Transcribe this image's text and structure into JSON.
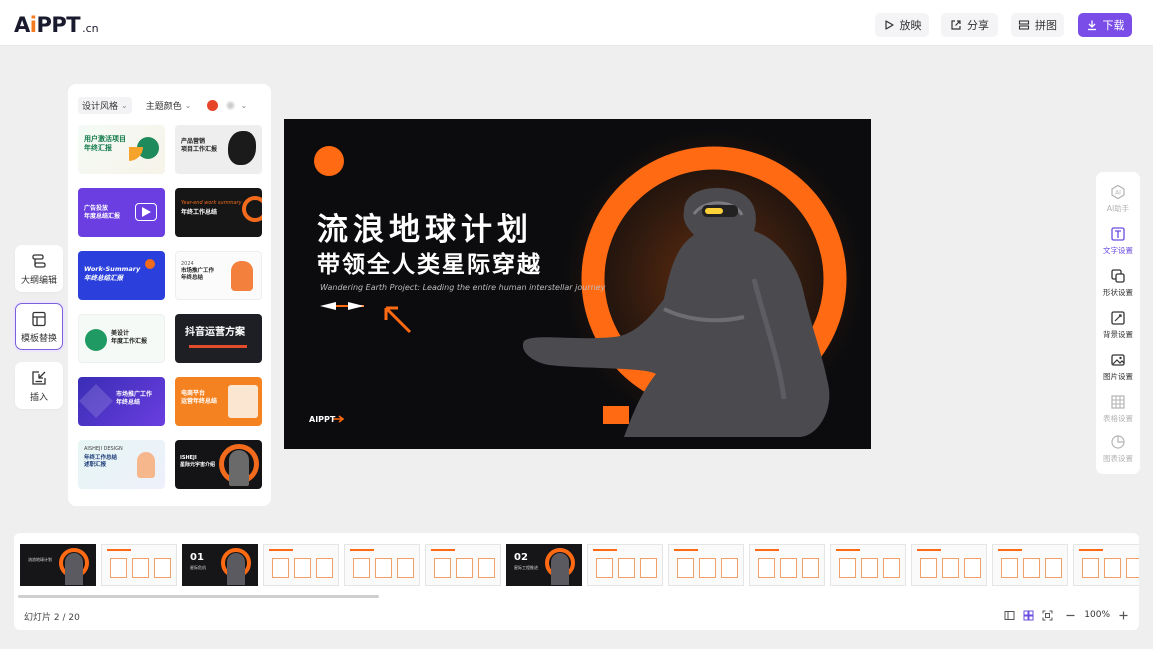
{
  "app": {
    "logo_text": "AiPPT",
    "logo_suffix": ".cn"
  },
  "toolbar": {
    "play_label": "放映",
    "share_label": "分享",
    "puzzle_label": "拼图",
    "download_label": "下载",
    "accent_color": "#7b4de8"
  },
  "left_tools": [
    {
      "label": "大纲编辑",
      "icon": "outline-icon"
    },
    {
      "label": "模板替换",
      "icon": "template-icon"
    },
    {
      "label": "插入",
      "icon": "insert-icon"
    }
  ],
  "template_panel": {
    "filter_style": "设计风格",
    "filter_color": "主题颜色",
    "selected_color": "#e6452a",
    "templates": [
      {
        "title": "用户激活项目\n年终汇报",
        "subtitle": ""
      },
      {
        "title": "产品营销\n项目工作汇报",
        "subtitle": ""
      },
      {
        "title": "广告投放\n年度总结汇报",
        "subtitle": ""
      },
      {
        "title": "年终工作总结",
        "subtitle": "Year-end work summary"
      },
      {
        "title": "Work-Summary\n年终总结汇报",
        "subtitle": ""
      },
      {
        "title": "市场推广工作\n年终总结",
        "subtitle": "2024"
      },
      {
        "title": "美设计\n年度工作汇报",
        "subtitle": ""
      },
      {
        "title": "抖音运营方案",
        "subtitle": ""
      },
      {
        "title": "市场推广工作\n年终总结",
        "subtitle": ""
      },
      {
        "title": "电商平台\n运营年终总结",
        "subtitle": ""
      },
      {
        "title": "年终工作总结\n述职汇报",
        "subtitle": "AISHEJI DESIGN"
      },
      {
        "title": "ISHEJI\n星际元宇宙介绍",
        "subtitle": ""
      }
    ]
  },
  "slide": {
    "title_line1": "流浪地球计划",
    "title_line2": "带领全人类星际穿越",
    "subtitle": "Wandering Earth Project: Leading the entire human interstellar journey",
    "brand": "AIPPT",
    "accent": "#ff6a13"
  },
  "right_tools": [
    {
      "label": "AI助手",
      "icon": "ai-assistant-icon",
      "state": "disabled"
    },
    {
      "label": "文字设置",
      "icon": "text-settings-icon",
      "state": "active"
    },
    {
      "label": "形状设置",
      "icon": "shape-settings-icon",
      "state": "normal"
    },
    {
      "label": "背景设置",
      "icon": "background-settings-icon",
      "state": "normal"
    },
    {
      "label": "图片设置",
      "icon": "image-settings-icon",
      "state": "normal"
    },
    {
      "label": "表格设置",
      "icon": "table-settings-icon",
      "state": "disabled"
    },
    {
      "label": "图表设置",
      "icon": "chart-settings-icon",
      "state": "disabled"
    }
  ],
  "thumbnails": [
    {
      "num": "",
      "sub": "流浪地球计划",
      "dark": true
    },
    {
      "num": "",
      "sub": "",
      "dark": false
    },
    {
      "num": "01",
      "sub": "星际危机",
      "dark": true
    },
    {
      "num": "",
      "sub": "",
      "dark": false
    },
    {
      "num": "",
      "sub": "",
      "dark": false
    },
    {
      "num": "",
      "sub": "",
      "dark": false
    },
    {
      "num": "02",
      "sub": "星际工程推进",
      "dark": true
    },
    {
      "num": "",
      "sub": "",
      "dark": false
    },
    {
      "num": "",
      "sub": "",
      "dark": false
    },
    {
      "num": "",
      "sub": "",
      "dark": false
    },
    {
      "num": "",
      "sub": "",
      "dark": false
    },
    {
      "num": "",
      "sub": "",
      "dark": false
    },
    {
      "num": "",
      "sub": "",
      "dark": false
    },
    {
      "num": "",
      "sub": "",
      "dark": false
    }
  ],
  "status": {
    "slide_counter": "幻灯片  2 / 20",
    "zoom": "100%"
  }
}
